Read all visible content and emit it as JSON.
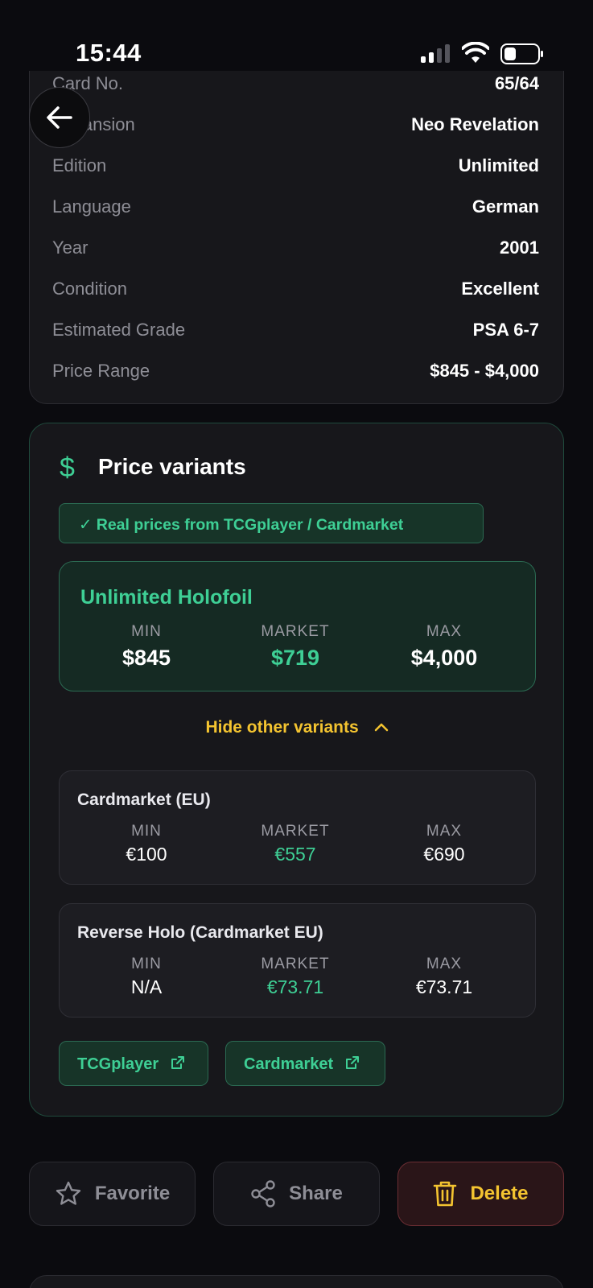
{
  "status": {
    "time": "15:44"
  },
  "details": [
    {
      "label": "Card No.",
      "value": "65/64"
    },
    {
      "label": "Expansion",
      "value": "Neo Revelation"
    },
    {
      "label": "Edition",
      "value": "Unlimited"
    },
    {
      "label": "Language",
      "value": "German"
    },
    {
      "label": "Year",
      "value": "2001"
    },
    {
      "label": "Condition",
      "value": "Excellent"
    },
    {
      "label": "Estimated Grade",
      "value": "PSA 6-7"
    },
    {
      "label": "Price Range",
      "value": "$845 - $4,000"
    }
  ],
  "price_variants": {
    "icon": "$",
    "title": "Price variants",
    "badge": "✓ Real prices from TCGplayer / Cardmarket",
    "main": {
      "name": "Unlimited Holofoil",
      "min_label": "MIN",
      "min": "$845",
      "market_label": "MARKET",
      "market": "$719",
      "max_label": "MAX",
      "max": "$4,000"
    },
    "toggle_label": "Hide other variants",
    "others": [
      {
        "name": "Cardmarket (EU)",
        "min_label": "MIN",
        "min": "€100",
        "market_label": "MARKET",
        "market": "€557",
        "max_label": "MAX",
        "max": "€690"
      },
      {
        "name": "Reverse Holo (Cardmarket EU)",
        "min_label": "MIN",
        "min": "N/A",
        "market_label": "MARKET",
        "market": "€73.71",
        "max_label": "MAX",
        "max": "€73.71"
      }
    ],
    "links": [
      {
        "label": "TCGplayer"
      },
      {
        "label": "Cardmarket"
      }
    ]
  },
  "actions": {
    "favorite": "Favorite",
    "share": "Share",
    "delete": "Delete"
  },
  "colors": {
    "accent_green": "#3ecf95",
    "accent_yellow": "#f4c430",
    "background": "#0b0b0f",
    "card": "#17171b"
  }
}
